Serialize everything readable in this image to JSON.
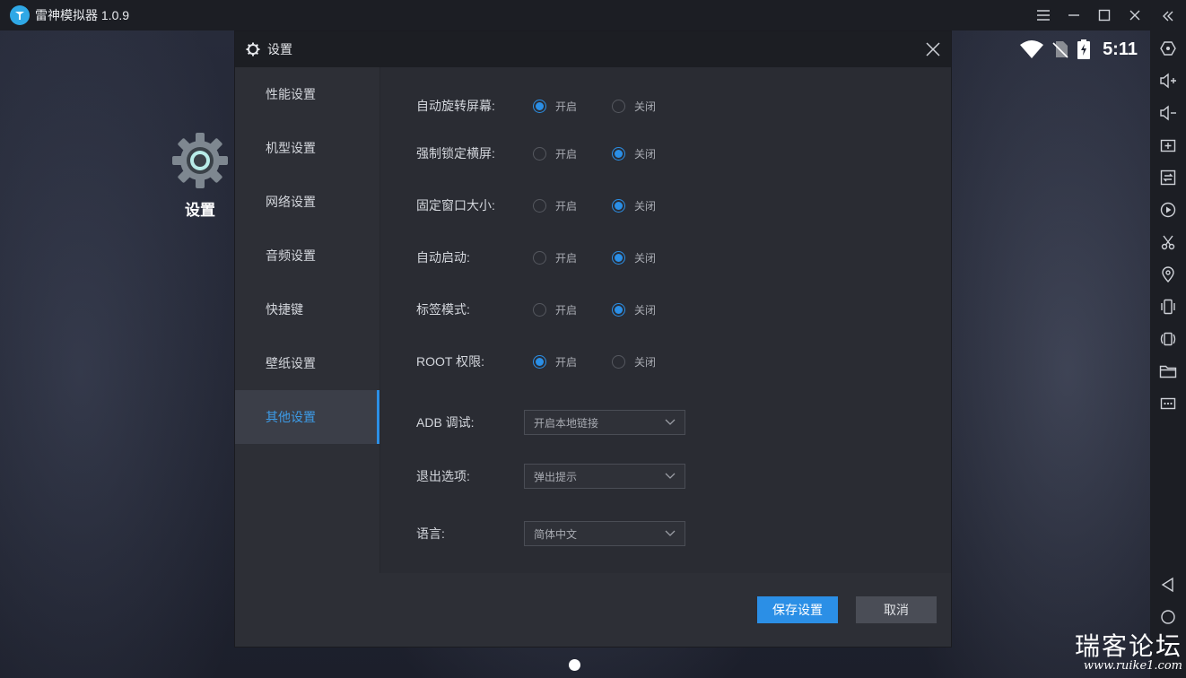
{
  "app": {
    "title": "雷神模拟器 1.0.9"
  },
  "status": {
    "time": "5:11"
  },
  "desktop": {
    "settings_label": "设置"
  },
  "dialog": {
    "title": "设置",
    "nav": [
      {
        "label": "性能设置",
        "active": false
      },
      {
        "label": "机型设置",
        "active": false
      },
      {
        "label": "网络设置",
        "active": false
      },
      {
        "label": "音频设置",
        "active": false
      },
      {
        "label": "快捷键",
        "active": false
      },
      {
        "label": "壁纸设置",
        "active": false
      },
      {
        "label": "其他设置",
        "active": true
      }
    ],
    "options": [
      {
        "label": "自动旋转屏幕:",
        "on": "开启",
        "off": "关闭",
        "selected": "on"
      },
      {
        "label": "强制锁定横屏:",
        "on": "开启",
        "off": "关闭",
        "selected": "off"
      },
      {
        "label": "固定窗口大小:",
        "on": "开启",
        "off": "关闭",
        "selected": "off"
      },
      {
        "label": "自动启动:",
        "on": "开启",
        "off": "关闭",
        "selected": "off"
      },
      {
        "label": "标签模式:",
        "on": "开启",
        "off": "关闭",
        "selected": "off"
      },
      {
        "label": "ROOT 权限:",
        "on": "开启",
        "off": "关闭",
        "selected": "on"
      }
    ],
    "selects": [
      {
        "label": "ADB 调试:",
        "value": "开启本地链接"
      },
      {
        "label": "退出选项:",
        "value": "弹出提示"
      },
      {
        "label": "语言:",
        "value": "简体中文"
      }
    ],
    "save_label": "保存设置",
    "cancel_label": "取消"
  },
  "watermark": {
    "text": "瑞客论坛",
    "url": "www.ruike1.com"
  },
  "colors": {
    "accent": "#2b8fe6",
    "dialog_bg": "#2d2f36",
    "titlebar_bg": "#1c1e24"
  }
}
